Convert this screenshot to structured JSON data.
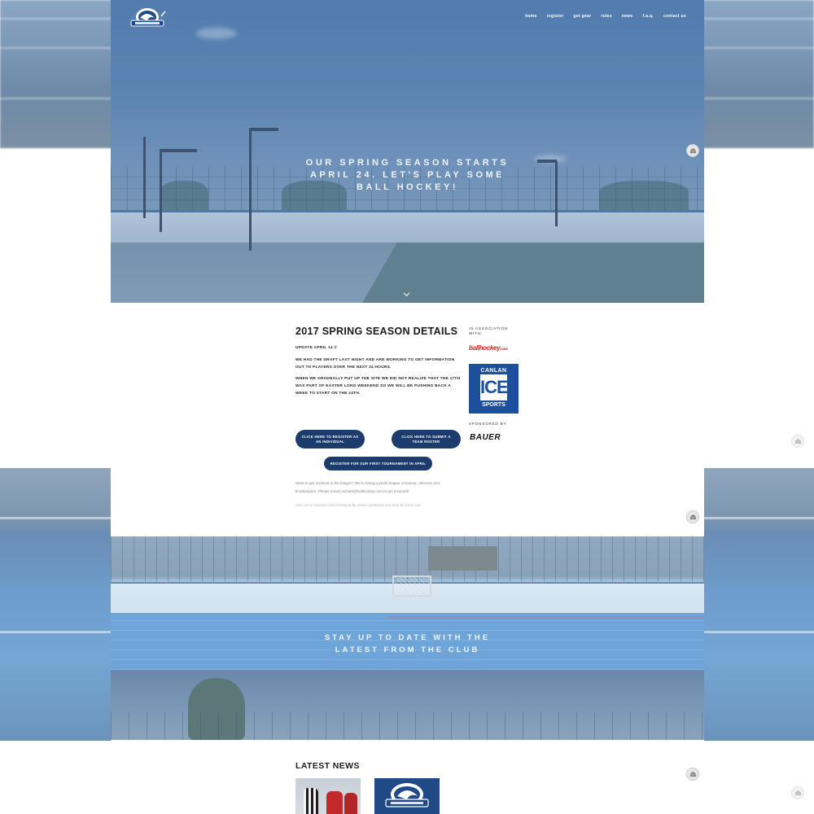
{
  "nav": {
    "items": [
      "home",
      "register",
      "get gear",
      "rules",
      "news",
      "f.a.q.",
      "contact us"
    ]
  },
  "hero": {
    "title_lines": [
      "OUR SPRING SEASON STARTS",
      "APRIL 24. LET'S PLAY SOME",
      "BALL HOCKEY!"
    ]
  },
  "details": {
    "heading": "2017 SPRING SEASON DETAILS",
    "update": "UPDATE APRIL 14 //",
    "para1": "WE HAD THE DRAFT LAST NIGHT AND ARE WORKING TO GET INFORMATION OUT TO PLAYERS OVER THE NEXT 24 HOURS.",
    "para2": "WHEN WE ORIGINALLY PUT UP THE SITE WE DID NOT REALIZE THAT THE 17TH WAS PART OF EASTER LONG WEEKEND SO WE WILL BE PUSHING BACK A WEEK TO START ON THE 24TH.",
    "btn_individual": "CLICK HERE TO REGISTER AS AN INDIVIDUAL",
    "btn_team": "CLICK HERE TO SUBMIT A TEAM ROSTER",
    "btn_tournament": "REGISTER FOR OUR FIRST TOURNAMENT IN APRIL",
    "involved_text": "Want to get involved in the league? We're hiring a youth league convenor, referees and timekeepers. Please email michael@ballhockey.com to get involved!",
    "faq_text": "Also we've started a list of frequently asked questions you should check out."
  },
  "sidebar": {
    "assoc_label": "IN ASSOCIATION WITH:",
    "ballhockey": "ballhockey",
    "ballhockey_suffix": ".com",
    "canlan_top": "CANLAN",
    "canlan_mid": "ICE",
    "canlan_bottom": "SPORTS",
    "sponsored_label": "SPONSORED BY:",
    "bauer": "BAUER"
  },
  "club": {
    "title_lines": [
      "STAY UP TO DATE WITH THE",
      "LATEST FROM THE CLUB"
    ]
  },
  "news": {
    "heading": "LATEST NEWS"
  },
  "colors": {
    "button_navy": "#1d3c6e",
    "canlan_blue": "#1c4f9c",
    "ballhockey_red": "#d0201d"
  }
}
